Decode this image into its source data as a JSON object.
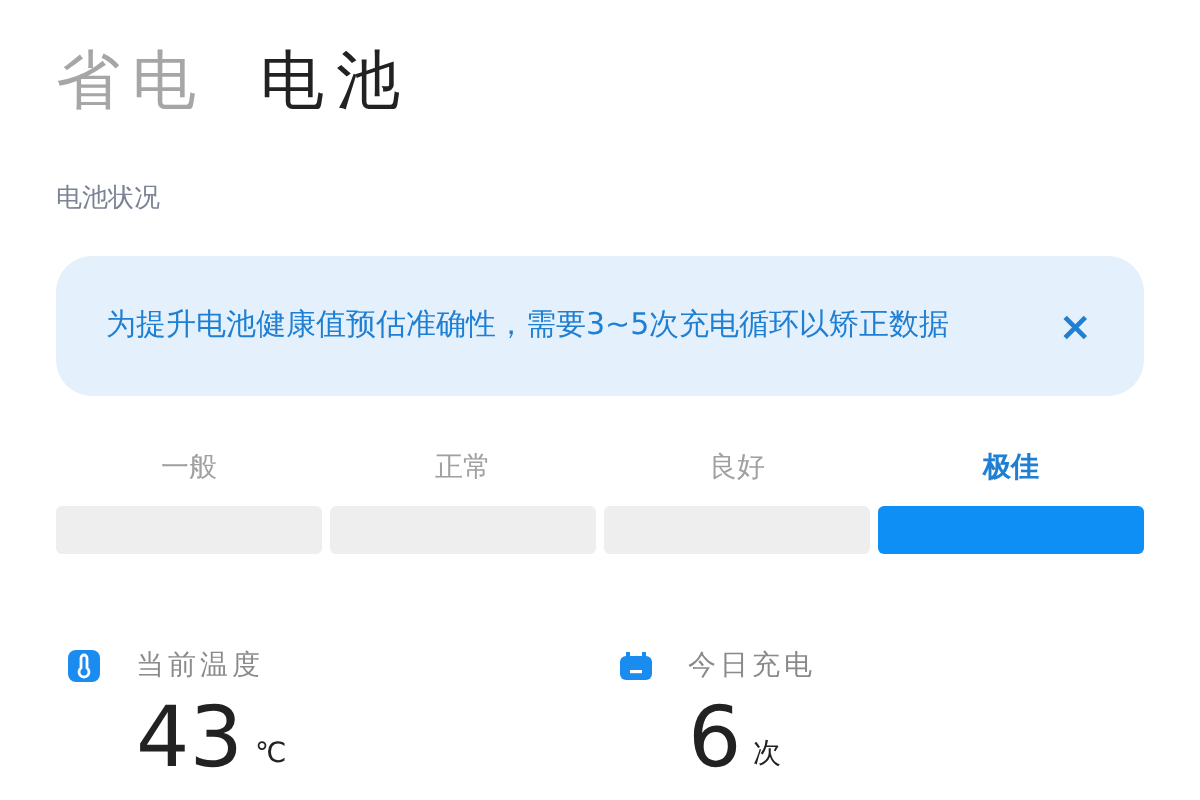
{
  "tabs": [
    {
      "label": "省电",
      "selected": false
    },
    {
      "label": "电池",
      "selected": true
    }
  ],
  "section_title": "电池状况",
  "notice": {
    "text": "为提升电池健康值预估准确性，需要3~5次充电循环以矫正数据",
    "close": "×"
  },
  "health_levels": [
    {
      "label": "一般",
      "selected": false
    },
    {
      "label": "正常",
      "selected": false
    },
    {
      "label": "良好",
      "selected": false
    },
    {
      "label": "极佳",
      "selected": true
    }
  ],
  "stats": [
    {
      "kind": "temperature",
      "label": "当前温度",
      "value": "43",
      "unit": "℃"
    },
    {
      "kind": "charges",
      "label": "今日充电",
      "value": "6",
      "unit": "次"
    }
  ]
}
